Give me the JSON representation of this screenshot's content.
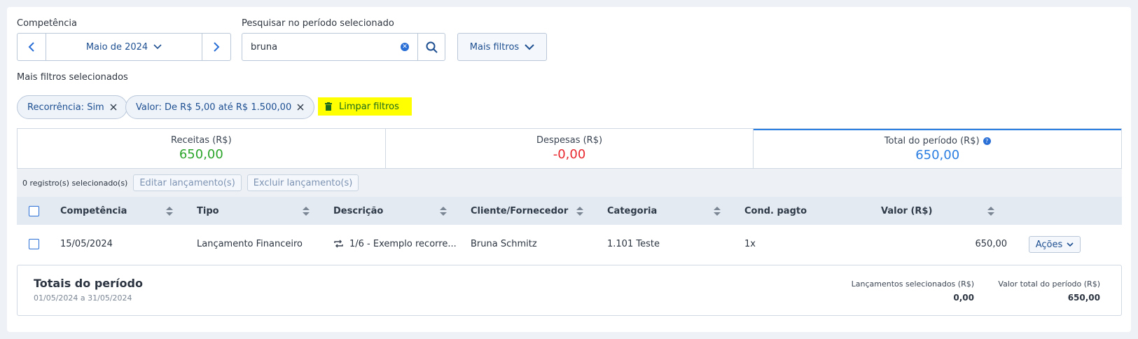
{
  "filters": {
    "competencia_label": "Competência",
    "month": "Maio de 2024",
    "search_label": "Pesquisar no período selecionado",
    "search_value": "bruna",
    "more_filters": "Mais filtros",
    "selected_label": "Mais filtros selecionados",
    "chips": [
      {
        "label": "Recorrência: Sim"
      },
      {
        "label": "Valor: De R$ 5,00 até R$ 1.500,00"
      }
    ],
    "clear_filters": "Limpar filtros"
  },
  "summary": {
    "receitas": {
      "label": "Receitas (R$)",
      "value": "650,00",
      "color": "#2aa52a"
    },
    "despesas": {
      "label": "Despesas (R$)",
      "value": "-0,00",
      "color": "#e8272d"
    },
    "total": {
      "label": "Total do período (R$)",
      "value": "650,00",
      "color": "#2a7de1"
    }
  },
  "actions": {
    "selected_count": "0 registro(s) selecionado(s)",
    "edit": "Editar lançamento(s)",
    "delete": "Excluir lançamento(s)"
  },
  "table": {
    "columns": {
      "competencia": "Competência",
      "tipo": "Tipo",
      "descricao": "Descrição",
      "cliente": "Cliente/Fornecedor",
      "categoria": "Categoria",
      "cond": "Cond. pagto",
      "valor": "Valor (R$)"
    },
    "rows": [
      {
        "competencia": "15/05/2024",
        "tipo": "Lançamento Financeiro",
        "descricao": "1/6 - Exemplo recorre...",
        "cliente": "Bruna Schmitz",
        "categoria": "1.101 Teste",
        "cond": "1x",
        "valor": "650,00",
        "acoes": "Ações"
      }
    ]
  },
  "totals": {
    "title": "Totais do período",
    "range": "01/05/2024 a 31/05/2024",
    "selected_label": "Lançamentos selecionados (R$)",
    "selected_value": "0,00",
    "total_label": "Valor total do período (R$)",
    "total_value": "650,00"
  }
}
